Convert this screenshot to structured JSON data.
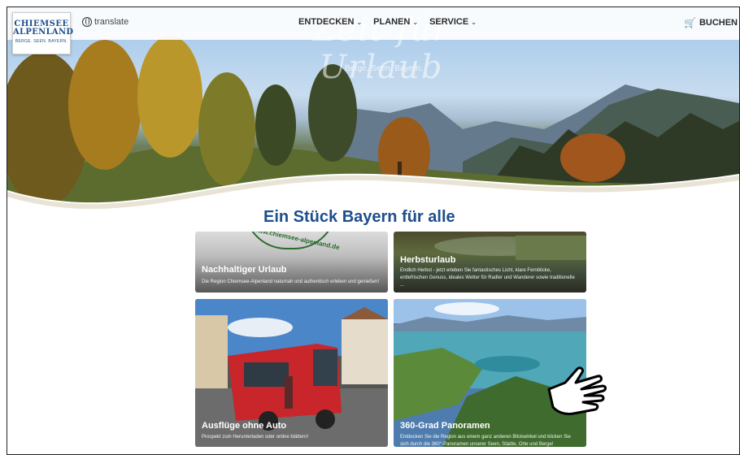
{
  "header": {
    "logo": {
      "line1": "CHIEMSEE",
      "line2": "ALPENLAND",
      "line3": "BERGE. SEEN. BAYERN."
    },
    "translate_label": "translate",
    "nav": [
      {
        "label": "ENTDECKEN"
      },
      {
        "label": "PLANEN"
      },
      {
        "label": "SERVICE"
      }
    ],
    "buchen_label": "BUCHEN"
  },
  "hero": {
    "script_title": "Zeit für Urlaub",
    "tagline": "Berge. Seen. Bayern."
  },
  "headline": "Ein Stück Bayern für alle",
  "cards": [
    {
      "title": "Nachhaltiger Urlaub",
      "stamp": "www.chiemsee-alpenland.de",
      "desc": "Die Region Chiemsee-Alpenland naturnah und authentisch erleben und genießen!"
    },
    {
      "title": "Herbsturlaub",
      "desc": "Endlich Herbst - jetzt erleben Sie fantastisches Licht, klare Fernblicke, entlefrischen Genuss, ideales Wetter für Radler und Wanderer sowie traditionelle ..."
    },
    {
      "title": "Ausflüge ohne Auto",
      "desc": "Prospekt zum Herunterladen oder online blättern!"
    },
    {
      "title": "360-Grad Panoramen",
      "desc": "Entdecken Sie die Region aus einem ganz anderen Blickwinkel und klicken Sie sich durch die 360°-Panoramen unserer Seen, Städte, Orte und Berge!"
    }
  ],
  "colors": {
    "brand_blue": "#1c4f8c",
    "cart": "#b01a4f"
  },
  "icons": [
    "globe-icon",
    "chevron-down-icon",
    "cart-icon",
    "hand-pointer-icon"
  ]
}
